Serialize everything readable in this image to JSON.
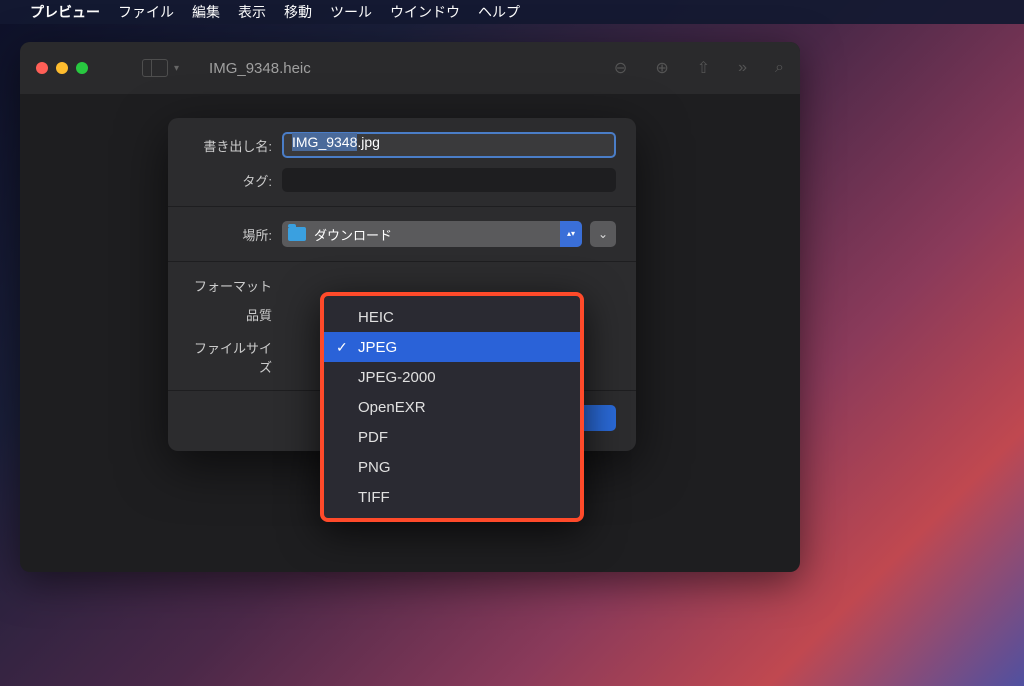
{
  "menubar": {
    "app_name": "プレビュー",
    "items": [
      "ファイル",
      "編集",
      "表示",
      "移動",
      "ツール",
      "ウインドウ",
      "ヘルプ"
    ]
  },
  "window": {
    "title": "IMG_9348.heic"
  },
  "sheet": {
    "export_name_label": "書き出し名:",
    "export_name_value": "IMG_9348.jpg",
    "export_name_selected_part": "IMG_9348",
    "export_name_rest": ".jpg",
    "tags_label": "タグ:",
    "location_label": "場所:",
    "location_value": "ダウンロード",
    "format_label": "フォーマット",
    "quality_label": "品質",
    "filesize_label": "ファイルサイズ"
  },
  "format_dropdown": {
    "options": [
      "HEIC",
      "JPEG",
      "JPEG-2000",
      "OpenEXR",
      "PDF",
      "PNG",
      "TIFF"
    ],
    "selected": "JPEG"
  }
}
